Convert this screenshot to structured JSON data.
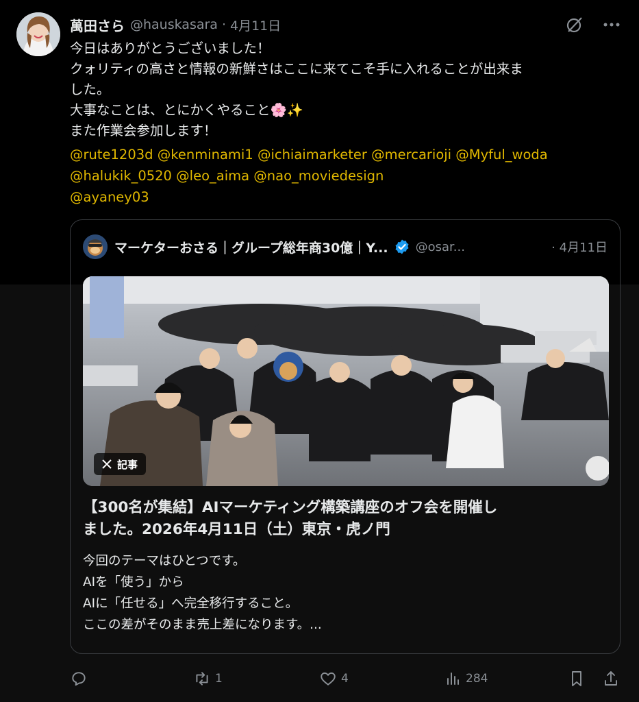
{
  "author": {
    "display_name": "萬田さら",
    "handle": "@hauskasara",
    "separator": "·",
    "date": "4月11日"
  },
  "post": {
    "lines": [
      "今日はありがとうございました！",
      "クォリティの高さと情報の新鮮さはここに来てこそ手に入れることが出来ま",
      "した。",
      "大事なことは、とにかくやること🌸✨",
      "また作業会参加します！"
    ],
    "mention_lines": [
      [
        "@rute1203d",
        "@kenminami1",
        "@ichiaimarketer",
        "@mercarioji",
        "@Myful_woda"
      ],
      [
        "@halukik_0520",
        "@leo_aima",
        "@nao_moviedesign"
      ],
      [
        "@ayaney03"
      ]
    ]
  },
  "quote": {
    "display_name": "マーケターおさる｜グループ総年商30億｜Y...",
    "handle": "@osar...",
    "separator": "·",
    "date": "4月11日",
    "media_badge": "記事",
    "title_lines": [
      "【300名が集結】AIマーケティング構築講座のオフ会を開催し",
      "ました。2026年4月11日（土）東京・虎ノ門"
    ],
    "body_lines": [
      "今回のテーマはひとつです。",
      "AIを「使う」から",
      "AIに「任せる」へ完全移行すること。",
      "ここの差がそのまま売上差になります。..."
    ]
  },
  "actions": {
    "reply_count": "",
    "repost_count": "1",
    "like_count": "4",
    "views_count": "284"
  },
  "colors": {
    "background": "#000000",
    "text": "#e7e9ea",
    "muted": "#8b9096",
    "mention": "#e2b900",
    "verified": "#1d9bf0",
    "border": "#3a3d41"
  },
  "icons": [
    "grok-icon",
    "more-icon",
    "x-logo-icon",
    "verified-badge-icon",
    "reply-icon",
    "repost-icon",
    "like-icon",
    "views-icon",
    "bookmark-icon",
    "share-icon"
  ]
}
